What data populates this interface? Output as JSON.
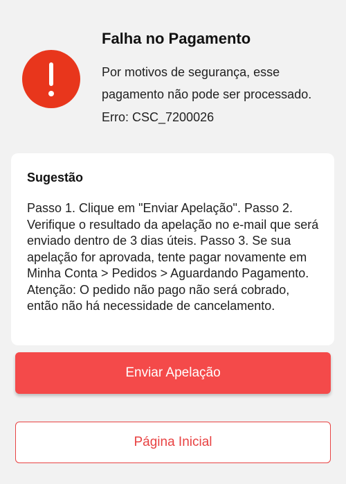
{
  "error": {
    "title": "Falha no Pagamento",
    "message": "Por motivos de segurança, esse pagamento não pode ser processado.",
    "code": "Erro: CSC_7200026",
    "icon": "exclamation-icon",
    "icon_color": "#e8361c"
  },
  "suggestion": {
    "title": "Sugestão",
    "text": "Passo 1. Clique em \"Enviar Apelação\". Passo 2. Verifique o resultado da apelação no e-mail que será enviado dentro de 3 dias úteis. Passo 3. Se sua apelação for aprovada, tente pagar novamente em Minha Conta > Pedidos > Aguardando Pagamento. Atenção: O pedido não pago não será cobrado, então não há necessidade de cancelamento."
  },
  "actions": {
    "primary_label": "Enviar Apelação",
    "secondary_label": "Página Inicial",
    "accent_color": "#f44a4a"
  }
}
